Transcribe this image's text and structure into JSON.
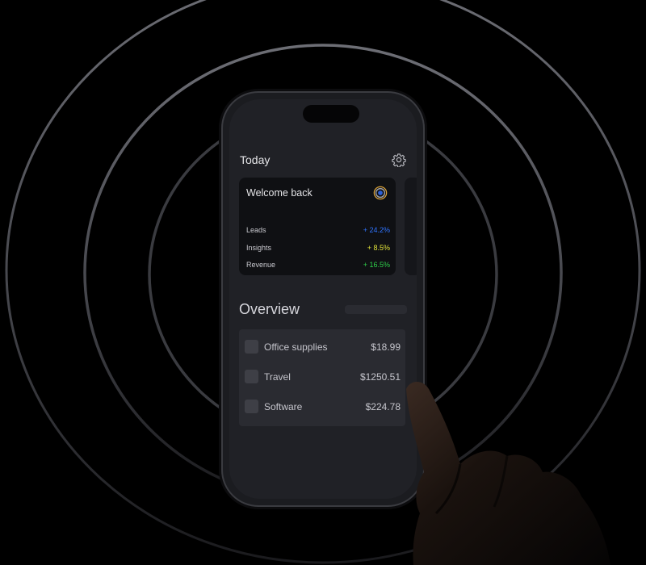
{
  "header": {
    "title": "Today",
    "settings_icon": "gear-icon"
  },
  "welcome_card": {
    "title": "Welcome back",
    "icon": "ring-badge-icon",
    "metrics": [
      {
        "label": "Leads",
        "value": "+ 24.2%",
        "color": "#2f74ff"
      },
      {
        "label": "Insights",
        "value": "+ 8.5%",
        "color": "#e3e43a"
      },
      {
        "label": "Revenue",
        "value": "+ 16.5%",
        "color": "#2fd14b"
      }
    ]
  },
  "overview": {
    "title": "Overview",
    "items": [
      {
        "name": "Office supplies",
        "amount": "$18.99"
      },
      {
        "name": "Travel",
        "amount": "$1250.51"
      },
      {
        "name": "Software",
        "amount": "$224.78"
      }
    ]
  }
}
